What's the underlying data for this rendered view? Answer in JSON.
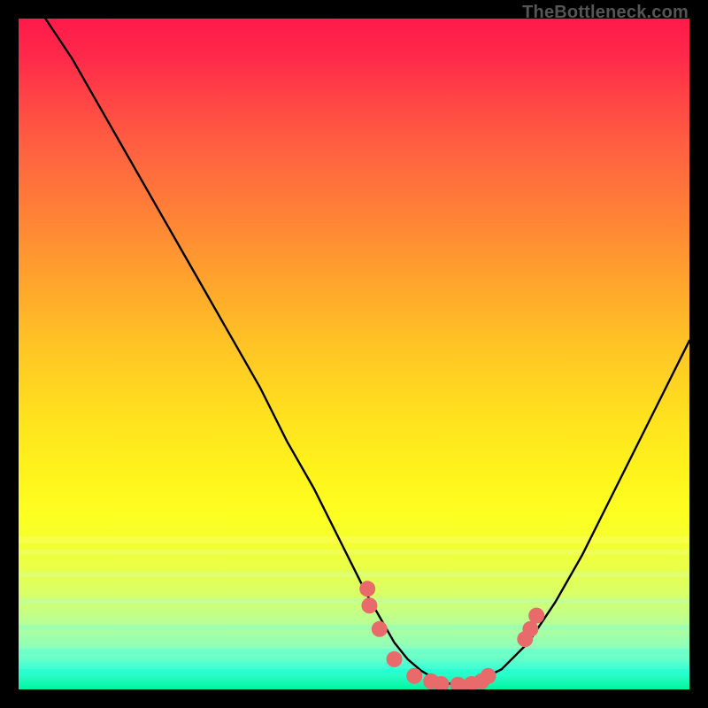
{
  "watermark": "TheBottleneck.com",
  "colors": {
    "dot_fill": "#e86a6a",
    "curve_stroke": "#000000"
  },
  "chart_data": {
    "type": "line",
    "title": "",
    "xlabel": "",
    "ylabel": "",
    "xlim": [
      0,
      100
    ],
    "ylim": [
      0,
      100
    ],
    "note": "Bottleneck-style curve on green-to-red gradient. Lower y = better (green). Values are estimated from pixel positions; axes are unlabeled in the source image.",
    "series": [
      {
        "name": "curve",
        "x": [
          4,
          8,
          12,
          16,
          20,
          24,
          28,
          32,
          36,
          40,
          44,
          48,
          52,
          56,
          58,
          60,
          62,
          64,
          66,
          68,
          72,
          76,
          80,
          84,
          88,
          92,
          96,
          100
        ],
        "y": [
          100,
          94,
          87,
          80,
          73,
          66,
          59,
          52,
          45,
          37,
          30,
          22,
          14,
          7,
          4.5,
          2.8,
          1.6,
          0.9,
          0.6,
          1.0,
          3.0,
          7.0,
          13,
          20,
          28,
          36,
          44,
          52
        ]
      }
    ],
    "dots": {
      "name": "highlighted-points",
      "x": [
        52.0,
        52.3,
        53.8,
        56.0,
        59.0,
        61.5,
        63.0,
        65.5,
        67.5,
        69.0,
        70.0,
        75.5,
        76.3,
        77.2
      ],
      "y": [
        15.0,
        12.5,
        9.0,
        4.5,
        2.0,
        1.2,
        0.8,
        0.7,
        0.8,
        1.2,
        2.0,
        7.5,
        9.0,
        11.0
      ]
    }
  }
}
